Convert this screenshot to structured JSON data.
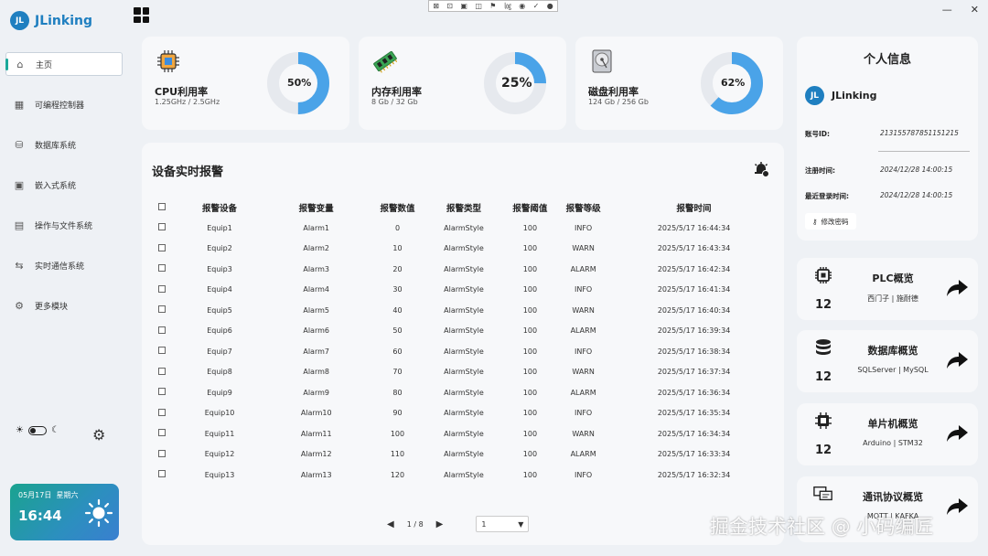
{
  "app": {
    "logo_mark": "JL",
    "name": "JLinking"
  },
  "toolbar_mini": {
    "items": [
      "⊠",
      "⊡",
      "▣",
      "◫",
      "⚑",
      "㏒",
      "◉",
      "✓",
      "●"
    ]
  },
  "sidebar": {
    "items": [
      {
        "label": "主页",
        "icon": "home-icon",
        "glyph": "⌂"
      },
      {
        "label": "可编程控制器",
        "icon": "chip-icon",
        "glyph": "▦"
      },
      {
        "label": "数据库系统",
        "icon": "database-icon",
        "glyph": "⛁"
      },
      {
        "label": "嵌入式系统",
        "icon": "cpu-icon",
        "glyph": "▣"
      },
      {
        "label": "操作与文件系统",
        "icon": "os-icon",
        "glyph": "▤"
      },
      {
        "label": "实时通信系统",
        "icon": "network-icon",
        "glyph": "⇆"
      },
      {
        "label": "更多模块",
        "icon": "settings-icon",
        "glyph": "⚙"
      }
    ],
    "theme_sun": "☀",
    "theme_moon": "☾",
    "gear": "⚙"
  },
  "clock": {
    "date": "05月17日",
    "weekday": "星期六",
    "time": "16:44"
  },
  "stats": [
    {
      "title": "CPU利用率",
      "sub": "1.25GHz / 2.5GHz",
      "percent_text": "50%",
      "percent": 50,
      "color": "#4aa3e8"
    },
    {
      "title": "内存利用率",
      "sub": "8 Gb / 32 Gb",
      "percent_text": "25%",
      "percent": 25,
      "color": "#4aa3e8"
    },
    {
      "title": "磁盘利用率",
      "sub": "124 Gb / 256 Gb",
      "percent_text": "62%",
      "percent": 62,
      "color": "#4aa3e8"
    }
  ],
  "alarms": {
    "title": "设备实时报警",
    "columns": [
      "报警设备",
      "报警变量",
      "报警数值",
      "报警类型",
      "报警阈值",
      "报警等级",
      "报警时间"
    ],
    "rows": [
      [
        "Equip1",
        "Alarm1",
        "0",
        "AlarmStyle",
        "100",
        "INFO",
        "2025/5/17 16:44:34"
      ],
      [
        "Equip2",
        "Alarm2",
        "10",
        "AlarmStyle",
        "100",
        "WARN",
        "2025/5/17 16:43:34"
      ],
      [
        "Equip3",
        "Alarm3",
        "20",
        "AlarmStyle",
        "100",
        "ALARM",
        "2025/5/17 16:42:34"
      ],
      [
        "Equip4",
        "Alarm4",
        "30",
        "AlarmStyle",
        "100",
        "INFO",
        "2025/5/17 16:41:34"
      ],
      [
        "Equip5",
        "Alarm5",
        "40",
        "AlarmStyle",
        "100",
        "WARN",
        "2025/5/17 16:40:34"
      ],
      [
        "Equip6",
        "Alarm6",
        "50",
        "AlarmStyle",
        "100",
        "ALARM",
        "2025/5/17 16:39:34"
      ],
      [
        "Equip7",
        "Alarm7",
        "60",
        "AlarmStyle",
        "100",
        "INFO",
        "2025/5/17 16:38:34"
      ],
      [
        "Equip8",
        "Alarm8",
        "70",
        "AlarmStyle",
        "100",
        "WARN",
        "2025/5/17 16:37:34"
      ],
      [
        "Equip9",
        "Alarm9",
        "80",
        "AlarmStyle",
        "100",
        "ALARM",
        "2025/5/17 16:36:34"
      ],
      [
        "Equip10",
        "Alarm10",
        "90",
        "AlarmStyle",
        "100",
        "INFO",
        "2025/5/17 16:35:34"
      ],
      [
        "Equip11",
        "Alarm11",
        "100",
        "AlarmStyle",
        "100",
        "WARN",
        "2025/5/17 16:34:34"
      ],
      [
        "Equip12",
        "Alarm12",
        "110",
        "AlarmStyle",
        "100",
        "ALARM",
        "2025/5/17 16:33:34"
      ],
      [
        "Equip13",
        "Alarm13",
        "120",
        "AlarmStyle",
        "100",
        "INFO",
        "2025/5/17 16:32:34"
      ]
    ],
    "pager": {
      "prev": "◀",
      "page_text": "1 / 8",
      "next": "▶",
      "select_value": "1",
      "select_caret": "▼"
    }
  },
  "profile": {
    "title": "个人信息",
    "logo_mark": "JL",
    "username": "JLinking",
    "account_label": "账号ID:",
    "account_value": "213155787851151215",
    "register_label": "注册时间:",
    "register_value": "2024/12/28  14:00:15",
    "last_login_label": "最近登录时间:",
    "last_login_value": "2024/12/28  14:00:15",
    "change_pw": "修改密码",
    "key_glyph": "⚷"
  },
  "overviews": [
    {
      "title": "PLC概览",
      "count": "12",
      "sub": "西门子 | 施耐德",
      "icon": "chip-icon"
    },
    {
      "title": "数据库概览",
      "count": "12",
      "sub": "SQLServer | MySQL",
      "icon": "database-icon"
    },
    {
      "title": "单片机概览",
      "count": "12",
      "sub": "Arduino | STM32",
      "icon": "microcontroller-icon"
    },
    {
      "title": "通讯协议概览",
      "count": "",
      "sub": "MQTT | KAFKA",
      "icon": "protocol-icon"
    }
  ],
  "window": {
    "minimize": "—",
    "close": "✕"
  },
  "watermark": "掘金技术社区 @ 小码编匠"
}
